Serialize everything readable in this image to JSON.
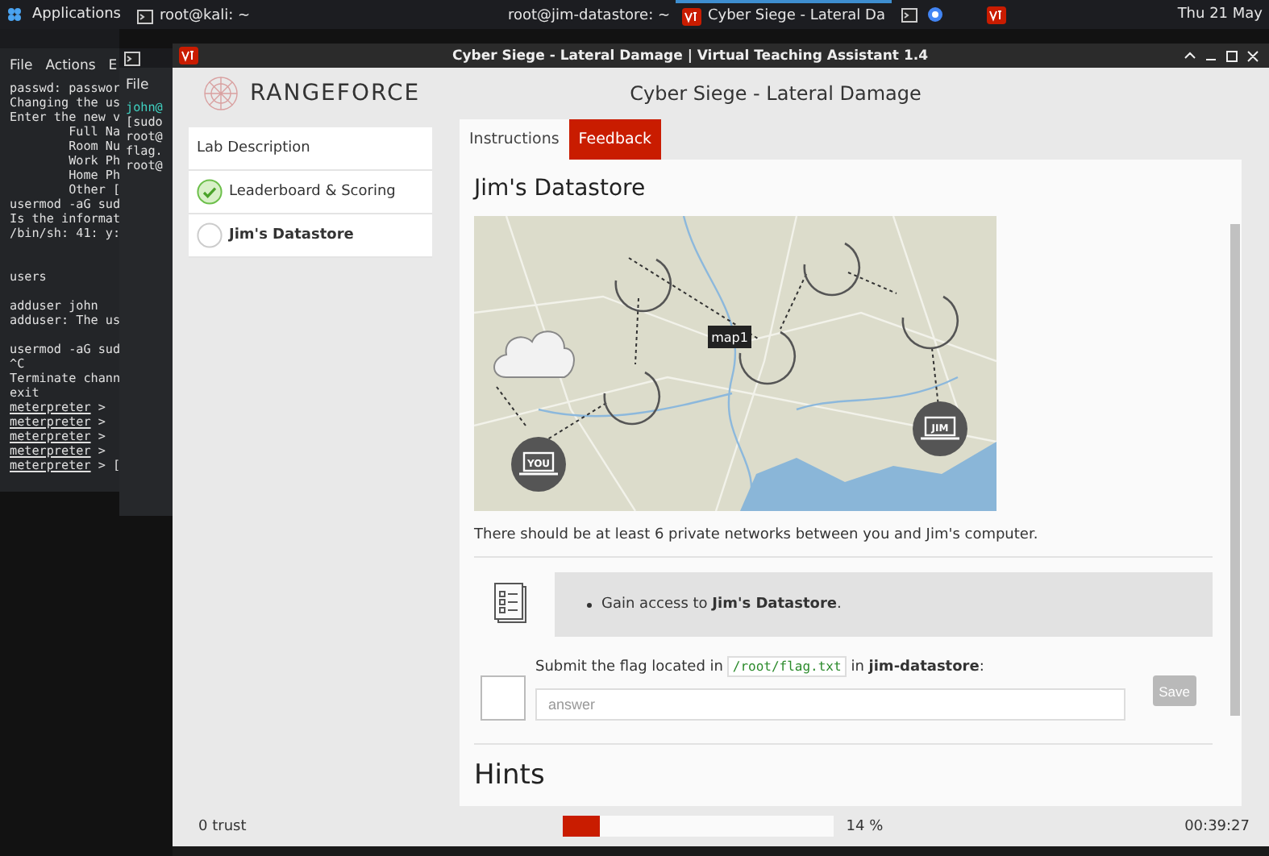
{
  "taskbar": {
    "menu": "Applications",
    "tasks": [
      {
        "label": "root@kali: ~",
        "selected": false
      },
      {
        "label": "root@jim-datastore: ~",
        "selected": false
      },
      {
        "label": "Cyber Siege - Lateral Da",
        "selected": true
      }
    ],
    "clock": "Thu 21 May"
  },
  "terminal": {
    "menu": [
      "File",
      "Actions",
      "E"
    ],
    "lines": [
      {
        "text": "passwd: passwor",
        "kind": "line"
      },
      {
        "text": "Changing the us",
        "kind": "line"
      },
      {
        "text": "Enter the new v",
        "kind": "line"
      },
      {
        "text": "        Full Na",
        "kind": "line"
      },
      {
        "text": "        Room Nu",
        "kind": "line"
      },
      {
        "text": "        Work Ph",
        "kind": "line"
      },
      {
        "text": "        Home Ph",
        "kind": "line"
      },
      {
        "text": "        Other [",
        "kind": "line"
      },
      {
        "text": "usermod -aG sud",
        "kind": "line"
      },
      {
        "text": "Is the informat",
        "kind": "line"
      },
      {
        "text": "/bin/sh: 41: y:",
        "kind": "line"
      },
      {
        "text": "users",
        "kind": "section"
      },
      {
        "text": "adduser john",
        "kind": "paragraph"
      },
      {
        "text": "adduser: The us",
        "kind": "line"
      },
      {
        "text": "usermod -aG sud",
        "kind": "paragraph"
      },
      {
        "text": "^C",
        "kind": "line"
      },
      {
        "text": "Terminate chann",
        "kind": "line"
      },
      {
        "text": "exit",
        "kind": "line"
      }
    ],
    "prompts": [
      "meterpreter",
      "meterpreter",
      "meterpreter",
      "meterpreter",
      "meterpreter"
    ],
    "prompt_suffix": [
      " >",
      " >",
      " >",
      " >",
      " > ["
    ]
  },
  "terminal_2": {
    "menu": "File",
    "lines": [
      {
        "text": "john@",
        "kind": "user"
      },
      {
        "text": "[sudo",
        "kind": "plain"
      },
      {
        "text": "root@",
        "kind": "plain"
      },
      {
        "text": "flag.",
        "kind": "plain"
      },
      {
        "text": "root@",
        "kind": "plain"
      }
    ]
  },
  "window": {
    "title": "Cyber Siege - Lateral Damage | Virtual Teaching Assistant 1.4"
  },
  "brand": "RANGEFORCE",
  "page_title": "Cyber Siege - Lateral Damage",
  "sidebar": {
    "items": [
      {
        "label": "Lab Description",
        "kind": "plain",
        "selected": false
      },
      {
        "label": "Leaderboard & Scoring",
        "kind": "task",
        "completed": true,
        "selected": false
      },
      {
        "label": "Jim's Datastore",
        "kind": "task",
        "completed": false,
        "selected": true
      }
    ]
  },
  "tabs": [
    {
      "label": "Instructions",
      "selected": true,
      "kind": "normal"
    },
    {
      "label": "Feedback",
      "selected": false,
      "kind": "accent"
    }
  ],
  "content": {
    "heading": "Jim's Datastore",
    "map": {
      "tooltip": "map1",
      "nodes": [
        {
          "label": "YOU"
        },
        {
          "label": "JIM"
        }
      ]
    },
    "description": "There should be at least 6 private networks between you and Jim's computer.",
    "objectives": [
      "Gain access to **Jim's Datastore**."
    ],
    "question": {
      "prefix": "Submit the flag located in",
      "code": "/root/flag.txt",
      "suffix": "in **jim-datastore**:",
      "checked": false,
      "placeholder": "answer",
      "button": "Save",
      "disabled": true
    },
    "hints_heading": "Hints"
  },
  "footer": {
    "trust": "0 trust",
    "progress": {
      "level": 0.14,
      "reading": "14 %"
    },
    "timer": "00:39:27"
  }
}
